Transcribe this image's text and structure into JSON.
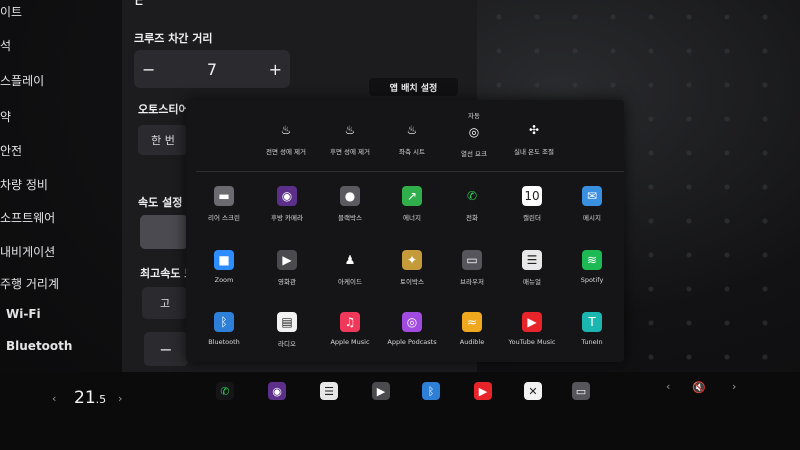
{
  "sidebar": {
    "items": [
      {
        "label": "이트"
      },
      {
        "label": "석"
      },
      {
        "label": "스플레이"
      },
      {
        "label": "약"
      },
      {
        "label": "안전"
      },
      {
        "label": "차량 정비"
      },
      {
        "label": "소프트웨어"
      },
      {
        "label": "내비게이션"
      },
      {
        "label": "주행 거리계"
      },
      {
        "label": "Wi-Fi"
      },
      {
        "label": "Bluetooth"
      }
    ]
  },
  "settings": {
    "top_cut_label": "ㄷ",
    "cruise_label": "크루즈 차간 거리",
    "cruise_minus": "−",
    "cruise_value": "7",
    "cruise_plus": "+",
    "autosteer_label": "오토스티어 모",
    "autosteer_value": "한 번",
    "speed_label": "속도 설정",
    "max_speed_label": "최고속도 모",
    "max_speed_value": "고",
    "bottom_minus": "−"
  },
  "launcher": {
    "title": "앱 배치 설정",
    "quick_controls": [
      {
        "label": "전면 성에 제거",
        "icon": "front-defrost-icon",
        "glyph": "♨"
      },
      {
        "label": "후면 성에 제거",
        "icon": "rear-defrost-icon",
        "glyph": "♨"
      },
      {
        "label": "좌측 시트",
        "icon": "seat-heater-icon",
        "glyph": "♨"
      },
      {
        "label": "열선 요크",
        "sublabel": "자동",
        "icon": "heated-yoke-icon",
        "glyph": "◎"
      },
      {
        "label": "실내 온도 조절",
        "icon": "fan-icon",
        "glyph": "✣"
      }
    ],
    "apps": [
      {
        "label": "리어 스크린",
        "icon": "rear-screen-icon",
        "color": "#6a6a70",
        "glyph": "▬"
      },
      {
        "label": "후방 카메라",
        "icon": "camera-icon",
        "color": "#5b2f8a",
        "glyph": "◉"
      },
      {
        "label": "블랙박스",
        "icon": "dashcam-icon",
        "color": "#5a5a60",
        "glyph": "●"
      },
      {
        "label": "에너지",
        "icon": "energy-icon",
        "color": "#2fae4b",
        "glyph": "↗"
      },
      {
        "label": "전화",
        "icon": "phone-icon",
        "color": "#151517",
        "glyph": "✆"
      },
      {
        "label": "캘린더",
        "icon": "calendar-icon",
        "color": "#ffffff",
        "glyph": "10"
      },
      {
        "label": "메시지",
        "icon": "messages-icon",
        "color": "#3a8fe0",
        "glyph": "✉"
      },
      {
        "label": "Zoom",
        "icon": "zoom-icon",
        "color": "#2d8cff",
        "glyph": "■"
      },
      {
        "label": "영화관",
        "icon": "theater-icon",
        "color": "#4a4a4f",
        "glyph": "▶"
      },
      {
        "label": "아케이드",
        "icon": "arcade-icon",
        "color": "#151517",
        "glyph": "♟"
      },
      {
        "label": "토이박스",
        "icon": "toybox-icon",
        "color": "#c59a3b",
        "glyph": "✦"
      },
      {
        "label": "브라우저",
        "icon": "browser-icon",
        "color": "#55555b",
        "glyph": "▭"
      },
      {
        "label": "매뉴얼",
        "icon": "manual-icon",
        "color": "#e8e8e8",
        "glyph": "☰"
      },
      {
        "label": "Spotify",
        "icon": "spotify-icon",
        "color": "#1db954",
        "glyph": "≋"
      },
      {
        "label": "Bluetooth",
        "icon": "bluetooth-icon",
        "color": "#2d7fd8",
        "glyph": "ᛒ"
      },
      {
        "label": "라디오",
        "icon": "radio-icon",
        "color": "#f2f2f2",
        "glyph": "▤"
      },
      {
        "label": "Apple Music",
        "icon": "apple-music-icon",
        "color": "#f0395a",
        "glyph": "♫"
      },
      {
        "label": "Apple Podcasts",
        "icon": "podcasts-icon",
        "color": "#a14be0",
        "glyph": "◎"
      },
      {
        "label": "Audible",
        "icon": "audible-icon",
        "color": "#f0a81e",
        "glyph": "≈"
      },
      {
        "label": "YouTube Music",
        "icon": "youtube-music-icon",
        "color": "#e8242b",
        "glyph": "▶"
      },
      {
        "label": "TuneIn",
        "icon": "tunein-icon",
        "color": "#1bb6b0",
        "glyph": "T"
      }
    ]
  },
  "dock": {
    "temperature": "21",
    "temperature_decimal": ".5",
    "left_chevron": "‹",
    "right_chevron": "›",
    "volume_left": "‹",
    "volume_right": "›",
    "apps": [
      {
        "icon": "phone-icon",
        "color": "#151517",
        "glyph": "✆"
      },
      {
        "icon": "camera-icon",
        "color": "#5b2f8a",
        "glyph": "◉"
      },
      {
        "icon": "manual-icon",
        "color": "#e8e8e8",
        "glyph": "☰"
      },
      {
        "icon": "theater-icon",
        "color": "#4a4a4f",
        "glyph": "▶"
      },
      {
        "icon": "bluetooth-icon",
        "color": "#2d7fd8",
        "glyph": "ᛒ"
      },
      {
        "icon": "youtube-music-icon",
        "color": "#e8242b",
        "glyph": "▶"
      },
      {
        "icon": "close-icon",
        "color": "#f2f2f2",
        "glyph": "✕"
      },
      {
        "icon": "browser-icon",
        "color": "#55555b",
        "glyph": "▭"
      }
    ],
    "volume_glyph": "🔇"
  }
}
